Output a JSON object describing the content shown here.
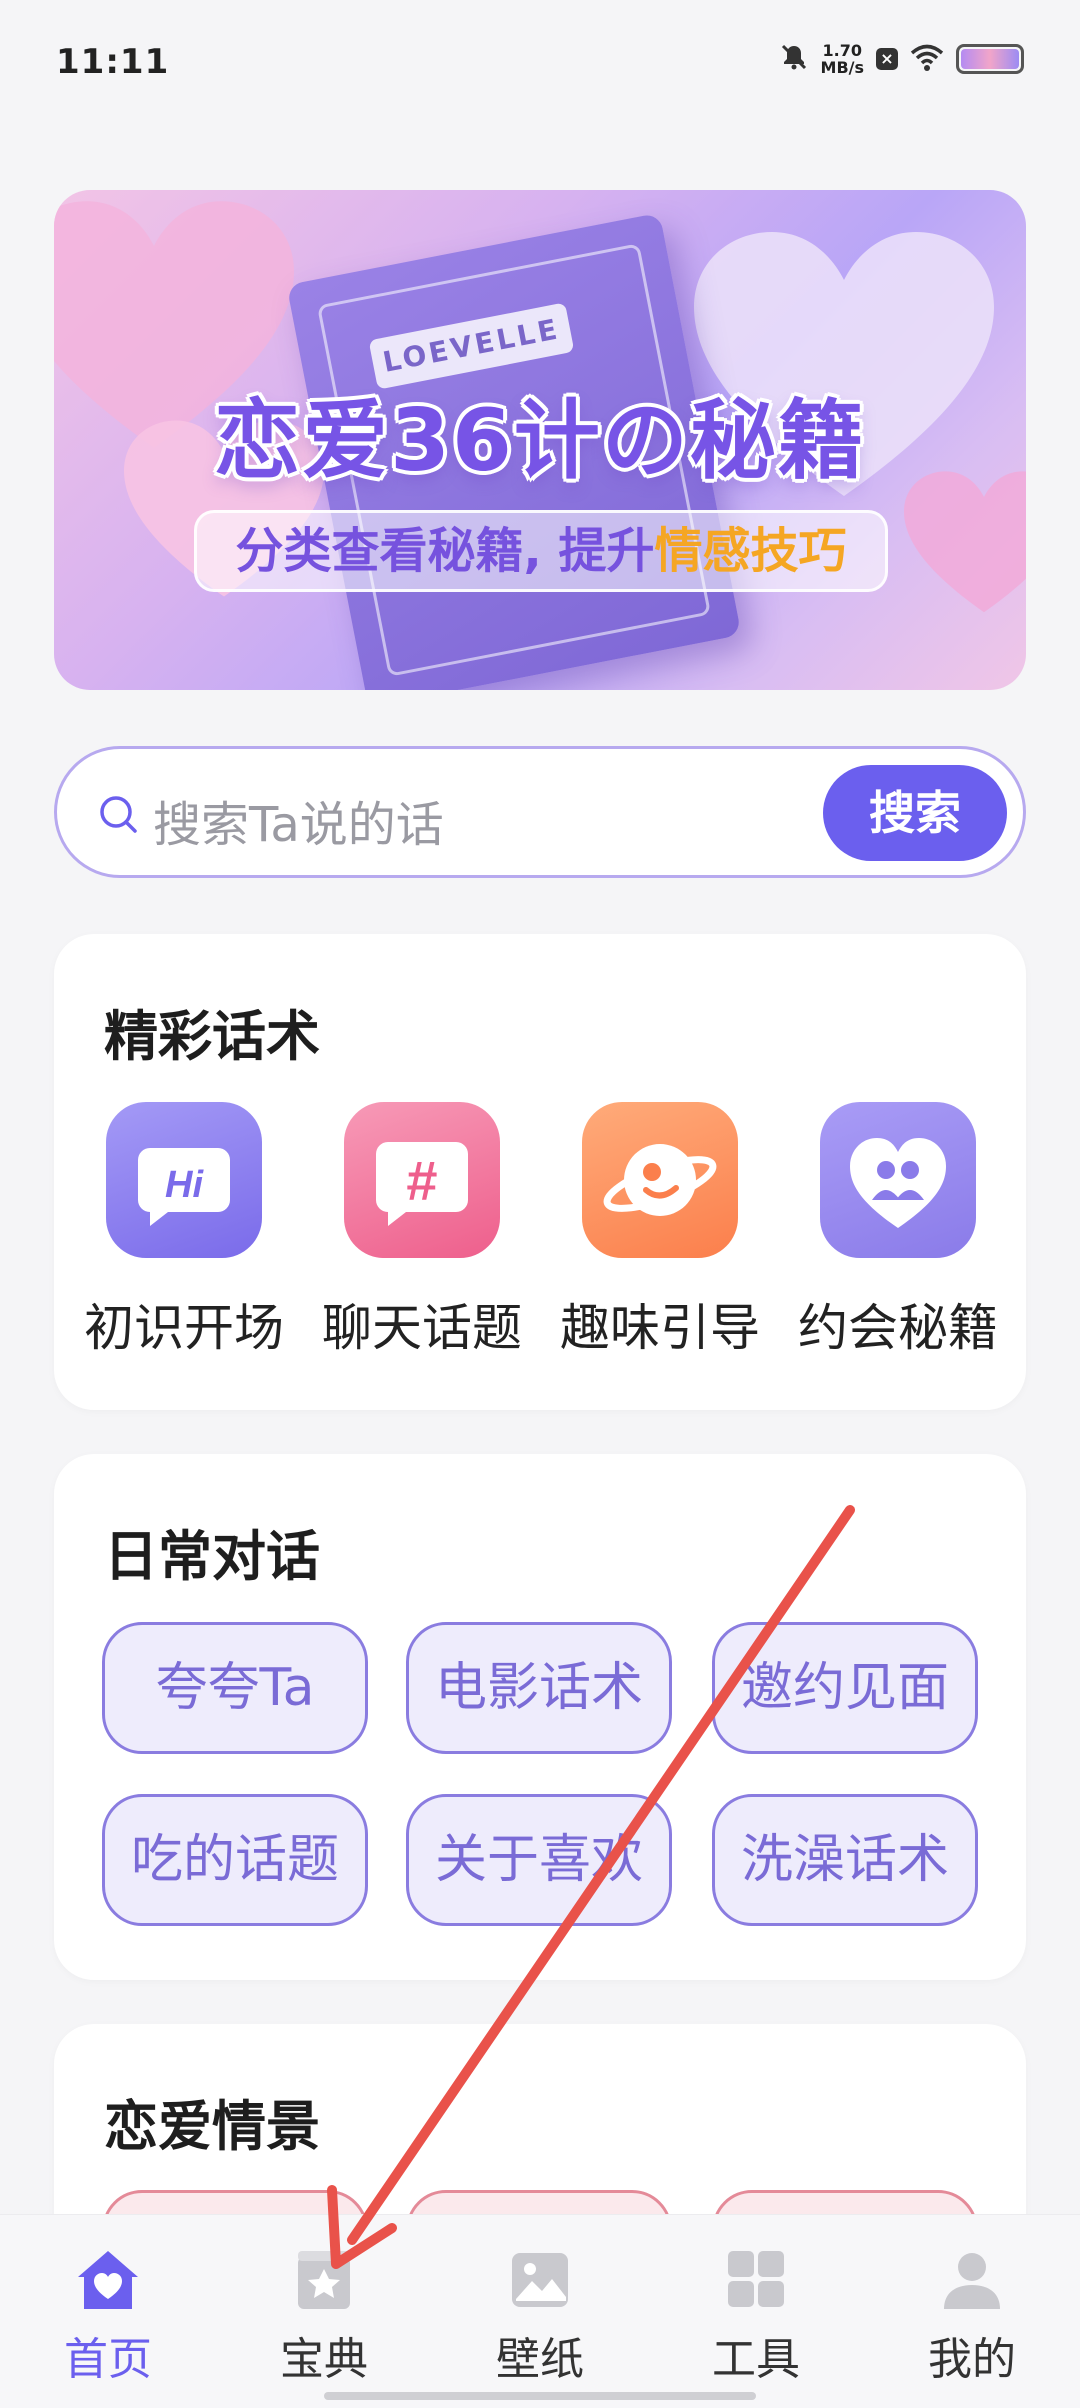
{
  "status_bar": {
    "time": "11:11",
    "net_speed_value": "1.70",
    "net_speed_unit": "MB/s"
  },
  "banner": {
    "book_label": "LOEVELLE",
    "title": "恋爱36计の秘籍",
    "subtitle_prefix": "分类查看秘籍, 提升",
    "subtitle_highlight": "情感技巧"
  },
  "search": {
    "placeholder": "搜索Ta说的话",
    "button_label": "搜索"
  },
  "featured": {
    "title": "精彩话术",
    "items": [
      {
        "label": "初识开场",
        "icon_text": "Hi"
      },
      {
        "label": "聊天话题",
        "icon_text": "#"
      },
      {
        "label": "趣味引导",
        "icon_text": ""
      },
      {
        "label": "约会秘籍",
        "icon_text": ""
      }
    ]
  },
  "daily": {
    "title": "日常对话",
    "chips": [
      "夸夸Ta",
      "电影话术",
      "邀约见面",
      "吃的话题",
      "关于喜欢",
      "洗澡话术"
    ]
  },
  "scenes": {
    "title": "恋爱情景"
  },
  "bottom_nav": {
    "items": [
      {
        "label": "首页",
        "icon": "home-heart-icon"
      },
      {
        "label": "宝典",
        "icon": "book-star-icon"
      },
      {
        "label": "壁纸",
        "icon": "image-icon"
      },
      {
        "label": "工具",
        "icon": "grid-icon"
      },
      {
        "label": "我的",
        "icon": "person-icon"
      }
    ]
  },
  "colors": {
    "accent": "#6b5fee",
    "chip_border": "#8a7ce0",
    "chip_bg": "#eeecfc",
    "annotation_arrow": "#e9524a"
  }
}
